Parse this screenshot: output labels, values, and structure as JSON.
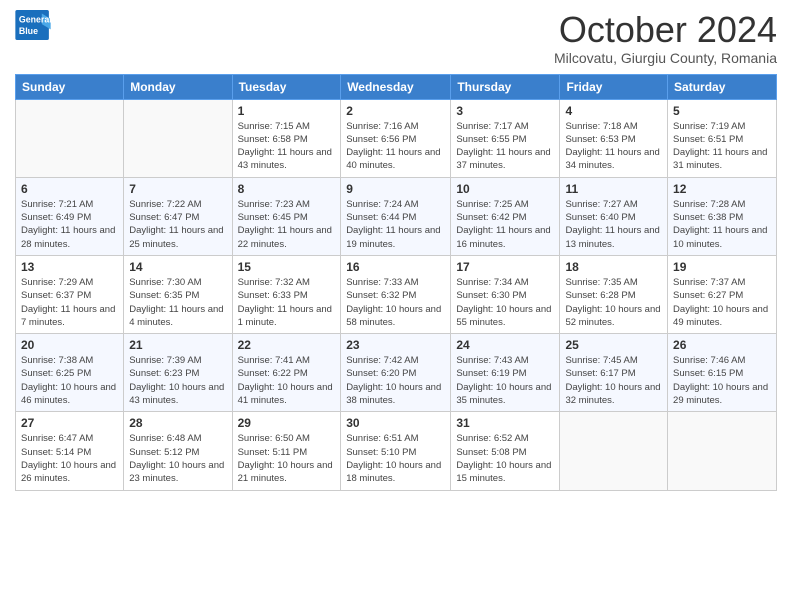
{
  "logo": {
    "line1": "General",
    "line2": "Blue"
  },
  "title": "October 2024",
  "subtitle": "Milcovatu, Giurgiu County, Romania",
  "days_of_week": [
    "Sunday",
    "Monday",
    "Tuesday",
    "Wednesday",
    "Thursday",
    "Friday",
    "Saturday"
  ],
  "weeks": [
    [
      {
        "day": "",
        "sunrise": "",
        "sunset": "",
        "daylight": ""
      },
      {
        "day": "",
        "sunrise": "",
        "sunset": "",
        "daylight": ""
      },
      {
        "day": "1",
        "sunrise": "Sunrise: 7:15 AM",
        "sunset": "Sunset: 6:58 PM",
        "daylight": "Daylight: 11 hours and 43 minutes."
      },
      {
        "day": "2",
        "sunrise": "Sunrise: 7:16 AM",
        "sunset": "Sunset: 6:56 PM",
        "daylight": "Daylight: 11 hours and 40 minutes."
      },
      {
        "day": "3",
        "sunrise": "Sunrise: 7:17 AM",
        "sunset": "Sunset: 6:55 PM",
        "daylight": "Daylight: 11 hours and 37 minutes."
      },
      {
        "day": "4",
        "sunrise": "Sunrise: 7:18 AM",
        "sunset": "Sunset: 6:53 PM",
        "daylight": "Daylight: 11 hours and 34 minutes."
      },
      {
        "day": "5",
        "sunrise": "Sunrise: 7:19 AM",
        "sunset": "Sunset: 6:51 PM",
        "daylight": "Daylight: 11 hours and 31 minutes."
      }
    ],
    [
      {
        "day": "6",
        "sunrise": "Sunrise: 7:21 AM",
        "sunset": "Sunset: 6:49 PM",
        "daylight": "Daylight: 11 hours and 28 minutes."
      },
      {
        "day": "7",
        "sunrise": "Sunrise: 7:22 AM",
        "sunset": "Sunset: 6:47 PM",
        "daylight": "Daylight: 11 hours and 25 minutes."
      },
      {
        "day": "8",
        "sunrise": "Sunrise: 7:23 AM",
        "sunset": "Sunset: 6:45 PM",
        "daylight": "Daylight: 11 hours and 22 minutes."
      },
      {
        "day": "9",
        "sunrise": "Sunrise: 7:24 AM",
        "sunset": "Sunset: 6:44 PM",
        "daylight": "Daylight: 11 hours and 19 minutes."
      },
      {
        "day": "10",
        "sunrise": "Sunrise: 7:25 AM",
        "sunset": "Sunset: 6:42 PM",
        "daylight": "Daylight: 11 hours and 16 minutes."
      },
      {
        "day": "11",
        "sunrise": "Sunrise: 7:27 AM",
        "sunset": "Sunset: 6:40 PM",
        "daylight": "Daylight: 11 hours and 13 minutes."
      },
      {
        "day": "12",
        "sunrise": "Sunrise: 7:28 AM",
        "sunset": "Sunset: 6:38 PM",
        "daylight": "Daylight: 11 hours and 10 minutes."
      }
    ],
    [
      {
        "day": "13",
        "sunrise": "Sunrise: 7:29 AM",
        "sunset": "Sunset: 6:37 PM",
        "daylight": "Daylight: 11 hours and 7 minutes."
      },
      {
        "day": "14",
        "sunrise": "Sunrise: 7:30 AM",
        "sunset": "Sunset: 6:35 PM",
        "daylight": "Daylight: 11 hours and 4 minutes."
      },
      {
        "day": "15",
        "sunrise": "Sunrise: 7:32 AM",
        "sunset": "Sunset: 6:33 PM",
        "daylight": "Daylight: 11 hours and 1 minute."
      },
      {
        "day": "16",
        "sunrise": "Sunrise: 7:33 AM",
        "sunset": "Sunset: 6:32 PM",
        "daylight": "Daylight: 10 hours and 58 minutes."
      },
      {
        "day": "17",
        "sunrise": "Sunrise: 7:34 AM",
        "sunset": "Sunset: 6:30 PM",
        "daylight": "Daylight: 10 hours and 55 minutes."
      },
      {
        "day": "18",
        "sunrise": "Sunrise: 7:35 AM",
        "sunset": "Sunset: 6:28 PM",
        "daylight": "Daylight: 10 hours and 52 minutes."
      },
      {
        "day": "19",
        "sunrise": "Sunrise: 7:37 AM",
        "sunset": "Sunset: 6:27 PM",
        "daylight": "Daylight: 10 hours and 49 minutes."
      }
    ],
    [
      {
        "day": "20",
        "sunrise": "Sunrise: 7:38 AM",
        "sunset": "Sunset: 6:25 PM",
        "daylight": "Daylight: 10 hours and 46 minutes."
      },
      {
        "day": "21",
        "sunrise": "Sunrise: 7:39 AM",
        "sunset": "Sunset: 6:23 PM",
        "daylight": "Daylight: 10 hours and 43 minutes."
      },
      {
        "day": "22",
        "sunrise": "Sunrise: 7:41 AM",
        "sunset": "Sunset: 6:22 PM",
        "daylight": "Daylight: 10 hours and 41 minutes."
      },
      {
        "day": "23",
        "sunrise": "Sunrise: 7:42 AM",
        "sunset": "Sunset: 6:20 PM",
        "daylight": "Daylight: 10 hours and 38 minutes."
      },
      {
        "day": "24",
        "sunrise": "Sunrise: 7:43 AM",
        "sunset": "Sunset: 6:19 PM",
        "daylight": "Daylight: 10 hours and 35 minutes."
      },
      {
        "day": "25",
        "sunrise": "Sunrise: 7:45 AM",
        "sunset": "Sunset: 6:17 PM",
        "daylight": "Daylight: 10 hours and 32 minutes."
      },
      {
        "day": "26",
        "sunrise": "Sunrise: 7:46 AM",
        "sunset": "Sunset: 6:15 PM",
        "daylight": "Daylight: 10 hours and 29 minutes."
      }
    ],
    [
      {
        "day": "27",
        "sunrise": "Sunrise: 6:47 AM",
        "sunset": "Sunset: 5:14 PM",
        "daylight": "Daylight: 10 hours and 26 minutes."
      },
      {
        "day": "28",
        "sunrise": "Sunrise: 6:48 AM",
        "sunset": "Sunset: 5:12 PM",
        "daylight": "Daylight: 10 hours and 23 minutes."
      },
      {
        "day": "29",
        "sunrise": "Sunrise: 6:50 AM",
        "sunset": "Sunset: 5:11 PM",
        "daylight": "Daylight: 10 hours and 21 minutes."
      },
      {
        "day": "30",
        "sunrise": "Sunrise: 6:51 AM",
        "sunset": "Sunset: 5:10 PM",
        "daylight": "Daylight: 10 hours and 18 minutes."
      },
      {
        "day": "31",
        "sunrise": "Sunrise: 6:52 AM",
        "sunset": "Sunset: 5:08 PM",
        "daylight": "Daylight: 10 hours and 15 minutes."
      },
      {
        "day": "",
        "sunrise": "",
        "sunset": "",
        "daylight": ""
      },
      {
        "day": "",
        "sunrise": "",
        "sunset": "",
        "daylight": ""
      }
    ]
  ]
}
